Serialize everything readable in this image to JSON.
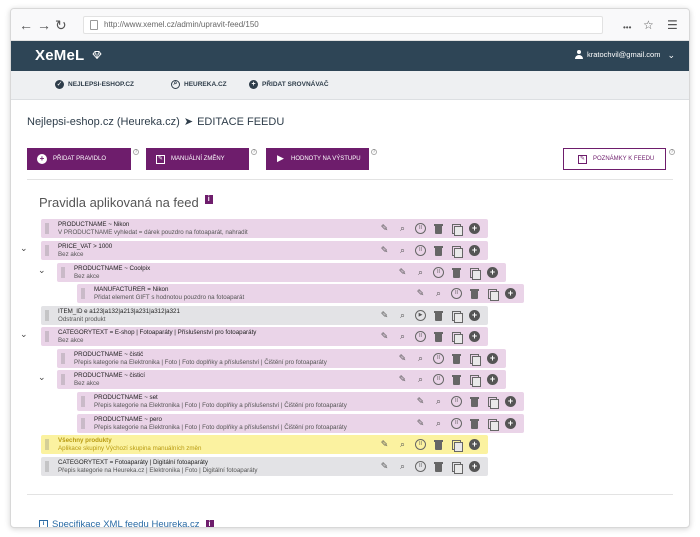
{
  "browser": {
    "url": "http://www.xemel.cz/admin/upravit-feed/150",
    "back_glyph": "←",
    "forward_glyph": "→",
    "reload_glyph": "↻",
    "menu_glyph": "•••",
    "star_glyph": "☆",
    "hamburger_glyph": "☰"
  },
  "header": {
    "logo": "XeMeL",
    "user_email": "kratochvil@gmail.com",
    "user_chevron": "⌄"
  },
  "tabs": [
    {
      "label": "NEJLEPSI-ESHOP.CZ",
      "icon": "check-circle-icon",
      "glyph": "✓"
    },
    {
      "label": "HEUREKA.CZ",
      "icon": "search-circle-icon",
      "glyph": "⌕"
    },
    {
      "label": "PŘIDAT SROVNÁVAČ",
      "icon": "plus-circle-icon",
      "glyph": "+"
    }
  ],
  "breadcrumb": {
    "feed": "Nejlepsi-eshop.cz (Heureka.cz)",
    "separator": "➤",
    "page": "EDITACE FEEDU"
  },
  "toolbar": {
    "add_rule": "PŘIDAT PRAVIDLO",
    "manual_changes": "MANUÁLNÍ ZMĚNY",
    "output_values": "HODNOTY NA VÝSTUPU",
    "feed_notes": "POZNÁMKY K FEEDU",
    "help_glyph": "?"
  },
  "section": {
    "title": "Pravidla aplikovaná na feed",
    "info_glyph": "i"
  },
  "rules": [
    {
      "title": "PRODUCTNAME ~ Nikon",
      "desc": "V PRODUCTNAME vyhledat = dárek pouzdro na fotoaparát, nahradit"
    },
    {
      "title": "PRICE_VAT > 1000",
      "desc": "Bez akce"
    },
    {
      "title": "PRODUCTNAME ~ Coolpix",
      "desc": "Bez akce"
    },
    {
      "title": "MANUFACTURER = Nikon",
      "desc": "Přidat element GIFT s hodnotou pouzdro na fotoaparát"
    },
    {
      "title": "ITEM_ID e a123|a132|a213|a231|a312|a321",
      "desc": "Odstranit produkt"
    },
    {
      "title": "CATEGORYTEXT = E-shop | Fotoaparáty | Příslušenství pro fotoaparáty",
      "desc": "Bez akce"
    },
    {
      "title": "PRODUCTNAME ~ čistič",
      "desc": "Přepis kategorie na Elektronika | Foto | Foto doplňky a příslušenství | Čištění pro fotoaparáty"
    },
    {
      "title": "PRODUCTNAME ~ čisticí",
      "desc": "Bez akce"
    },
    {
      "title": "PRODUCTNAME ~ set",
      "desc": "Přepis kategorie na Elektronika | Foto | Foto doplňky a příslušenství | Čištění pro fotoaparáty"
    },
    {
      "title": "PRODUCTNAME ~ pero",
      "desc": "Přepis kategorie na Elektronika | Foto | Foto doplňky a příslušenství | Čištění pro fotoaparáty"
    },
    {
      "title": "Všechny produkty",
      "desc": "Aplikace skupiny Výchozí skupina manuálních změn"
    },
    {
      "title": "CATEGORYTEXT = Fotoaparáty | Digitální fotoaparáty",
      "desc": "Přepis kategorie na Heureka.cz | Elektronika | Foto | Digitální fotoaparáty"
    }
  ],
  "actions": {
    "edit": "✎",
    "search": "⌕",
    "pause": "II",
    "play": "▶",
    "add": "+"
  },
  "chevron_glyph": "⌄",
  "footer": {
    "link": "Specifikace XML feedu Heureka.cz",
    "info_glyph": "i"
  }
}
